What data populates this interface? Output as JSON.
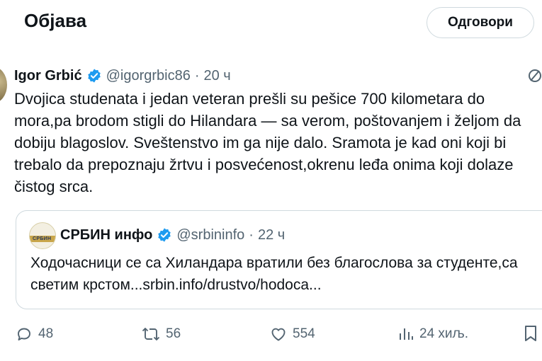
{
  "header": {
    "title": "Објава",
    "reply_label": "Одговори"
  },
  "tweet": {
    "author_name": "Igor Grbić",
    "handle": "@igorgrbic86",
    "separator": "·",
    "time": "20 ч",
    "text": "Dvojica studenata i jedan veteran prešli su pešice 700 kilometara do\nmora,pa brodom stigli do Hilandara — sa verom, poštovanjem i željom da\ndobiju blagoslov. Sveštenstvo im ga nije dalo. Sramota je kad oni koji bi\ntrebalo da prepoznaju žrtvu i posvećenost,okrenu leđa onima koji dolaze\nčistog srca."
  },
  "quote": {
    "author_name": "СРБИН инфо",
    "handle": "@srbininfo",
    "separator": "·",
    "time": "22 ч",
    "text": "Ходочасници се са Хиландара вратили без благослова за студенте,са\nсветим крстом...srbin.info/drustvo/hodoca...",
    "avatar_logo_text": "СРБИН"
  },
  "actions": {
    "replies": "48",
    "reposts": "56",
    "likes": "554",
    "views": "24 хиљ."
  },
  "colors": {
    "text_primary": "#0f1419",
    "text_secondary": "#536471",
    "verified_blue": "#1d9bf0",
    "border": "#cfd9de"
  },
  "icons": [
    "verified-badge-icon",
    "more-icon",
    "reply-icon",
    "repost-icon",
    "like-icon",
    "views-icon",
    "bookmark-icon"
  ]
}
